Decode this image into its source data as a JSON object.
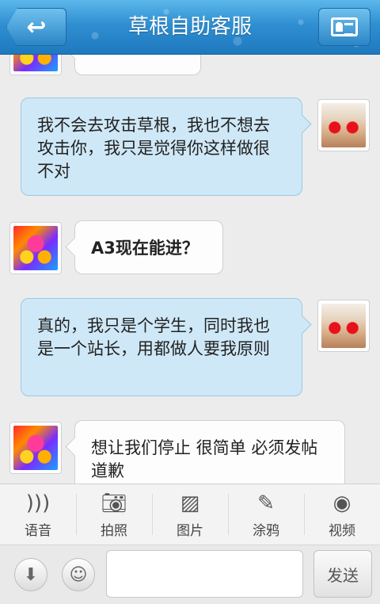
{
  "header": {
    "back_icon": "return-arrow-icon",
    "title": "草根自助客服",
    "card_icon": "contact-card-icon"
  },
  "messages": [
    {
      "side": "left",
      "text": ""
    },
    {
      "side": "right",
      "text": "我不会去攻击草根，我也不想去攻击你，我只是觉得你这样做很不对"
    },
    {
      "side": "left",
      "text": "A3现在能进？"
    },
    {
      "side": "right",
      "text": "真的，我只是个学生，同时我也是一个站长，用都做人要我原则"
    },
    {
      "side": "left",
      "text": "想让我们停止 很简单  必须发帖道歉"
    }
  ],
  "toolbar": {
    "voice": "语音",
    "photo": "拍照",
    "picture": "图片",
    "doodle": "涂鸦",
    "video": "视频"
  },
  "inputbar": {
    "placeholder": "",
    "send": "发送"
  }
}
